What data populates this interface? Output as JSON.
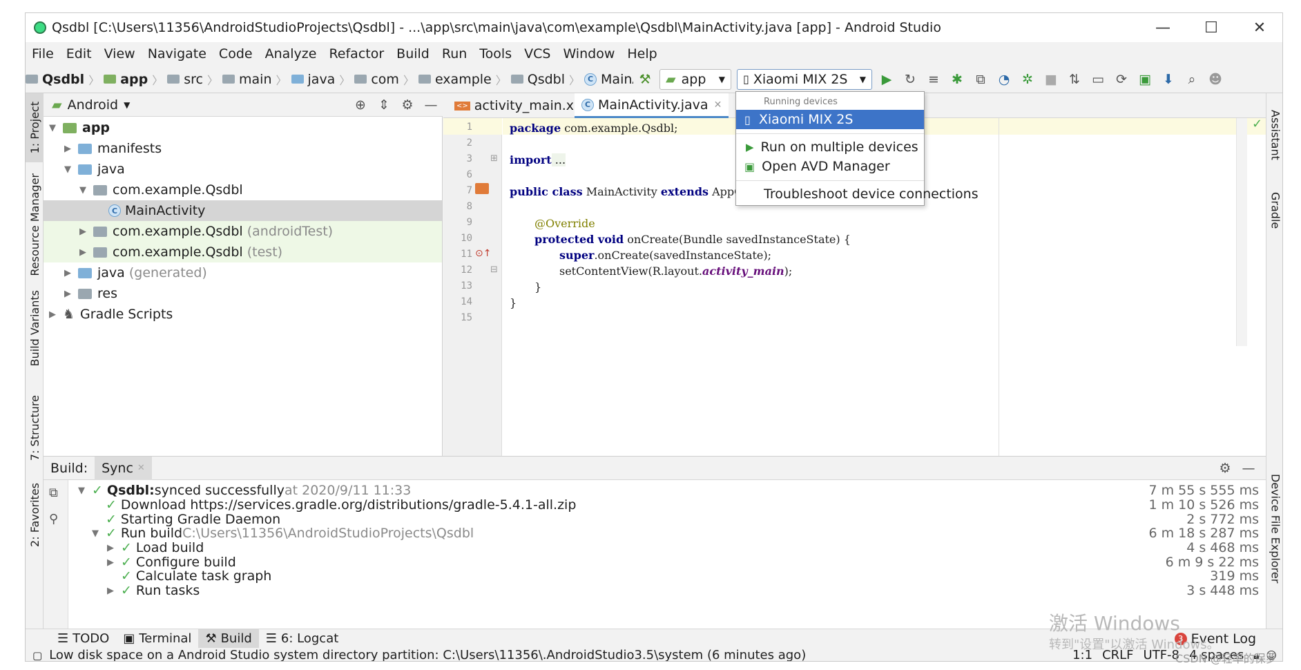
{
  "window": {
    "title": "Qsdbl [C:\\Users\\11356\\AndroidStudioProjects\\Qsdbl] - ...\\app\\src\\main\\java\\com\\example\\Qsdbl\\MainActivity.java [app] - Android Studio",
    "controls": {
      "minimize": "—",
      "maximize": "☐",
      "close": "✕"
    }
  },
  "menu": [
    "File",
    "Edit",
    "View",
    "Navigate",
    "Code",
    "Analyze",
    "Refactor",
    "Build",
    "Run",
    "Tools",
    "VCS",
    "Window",
    "Help"
  ],
  "breadcrumbs": [
    "Qsdbl",
    "app",
    "src",
    "main",
    "java",
    "com",
    "example",
    "Qsdbl",
    "MainActivity"
  ],
  "toolbar": {
    "module": "app",
    "device": "Xiaomi MIX 2S"
  },
  "device_dropdown": {
    "section": "Running devices",
    "selected": "Xiaomi MIX 2S",
    "items": [
      "Run on multiple devices",
      "Open AVD Manager",
      "Troubleshoot device connections"
    ]
  },
  "left_tabs": [
    "1: Project",
    "Resource Manager",
    "Build Variants",
    "7: Structure",
    "2: Favorites"
  ],
  "right_tabs": [
    "Assistant",
    "Gradle",
    "Device File Explorer"
  ],
  "project": {
    "view": "Android",
    "tree": [
      {
        "label": "app",
        "suffix": ""
      },
      {
        "label": "manifests",
        "suffix": ""
      },
      {
        "label": "java",
        "suffix": ""
      },
      {
        "label": "com.example.Qsdbl",
        "suffix": ""
      },
      {
        "label": "MainActivity",
        "suffix": ""
      },
      {
        "label": "com.example.Qsdbl",
        "suffix": "(androidTest)"
      },
      {
        "label": "com.example.Qsdbl",
        "suffix": "(test)"
      },
      {
        "label": "java",
        "suffix": "(generated)"
      },
      {
        "label": "res",
        "suffix": ""
      },
      {
        "label": "Gradle Scripts",
        "suffix": ""
      }
    ]
  },
  "editor": {
    "tabs": [
      "activity_main.xml",
      "MainActivity.java"
    ],
    "line_numbers": [
      "1",
      "2",
      "3",
      "6",
      "7",
      "8",
      "9",
      "10",
      "11",
      "12",
      "13",
      "14",
      "15"
    ],
    "code": {
      "l1_kw": "package",
      "l1_rest": " com.example.Qsdbl;",
      "l3_kw": "import",
      "l3_rest": " ...",
      "l7_kw1": "public class",
      "l7_mid": " MainActivity ",
      "l7_kw2": "extends",
      "l7_rest": " AppCompatActivity {",
      "l9": "@Override",
      "l10_kw": "protected void",
      "l10_rest": " onCreate(Bundle savedInstanceState) {",
      "l11_kw": "super",
      "l11_rest": ".onCreate(savedInstanceState);",
      "l12_a": "setContentView(R.layout.",
      "l12_f": "activity_main",
      "l12_b": ");",
      "l13": "}",
      "l14": "}"
    }
  },
  "build": {
    "label": "Build:",
    "tab": "Sync",
    "rows": [
      {
        "bold": "Qsdbl:",
        "text": " synced successfully",
        "dim": " at 2020/9/11 11:33",
        "time": "7 m 55 s 555 ms"
      },
      {
        "bold": "",
        "text": "Download https://services.gradle.org/distributions/gradle-5.4.1-all.zip",
        "dim": "",
        "time": "1 m 10 s 526 ms"
      },
      {
        "bold": "",
        "text": "Starting Gradle Daemon",
        "dim": "",
        "time": "2 s 772 ms"
      },
      {
        "bold": "",
        "text": "Run build",
        "dim": " C:\\Users\\11356\\AndroidStudioProjects\\Qsdbl",
        "time": "6 m 18 s 287 ms"
      },
      {
        "bold": "",
        "text": "Load build",
        "dim": "",
        "time": "4 s 468 ms"
      },
      {
        "bold": "",
        "text": "Configure build",
        "dim": "",
        "time": "6 m 9 s 22 ms"
      },
      {
        "bold": "",
        "text": "Calculate task graph",
        "dim": "",
        "time": "319 ms"
      },
      {
        "bold": "",
        "text": "Run tasks",
        "dim": "",
        "time": "3 s 448 ms"
      }
    ]
  },
  "bottom_tabs": [
    "TODO",
    "Terminal",
    "Build",
    "6: Logcat"
  ],
  "event_log": {
    "count": "3",
    "label": "Event Log"
  },
  "status": {
    "message": "Low disk space on a Android Studio system directory partition: C:\\Users\\11356\\.AndroidStudio3.5\\system (6 minutes ago)",
    "position": "1:1",
    "line_sep": "CRLF",
    "encoding": "UTF-8",
    "indent": "4 spaces"
  },
  "watermark": {
    "line1": "激活 Windows",
    "line2": "转到\"设置\"以激活 Windows。",
    "credit": "CSDN @轻率的保罗"
  }
}
